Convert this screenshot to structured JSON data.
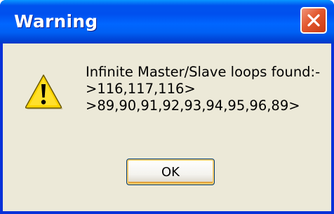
{
  "window": {
    "title": "Warning",
    "icon": "warning-icon",
    "close_icon": "close-icon"
  },
  "message": {
    "lines": [
      "Infinite Master/Slave loops found:-",
      ">116,117,116>",
      ">89,90,91,92,93,94,95,96,89>"
    ]
  },
  "buttons": {
    "ok_label": "OK"
  },
  "colors": {
    "titlebar": "#0053ee",
    "close_button": "#e2582e",
    "client_background": "#ece9d8",
    "warning_yellow": "#ffd400"
  }
}
